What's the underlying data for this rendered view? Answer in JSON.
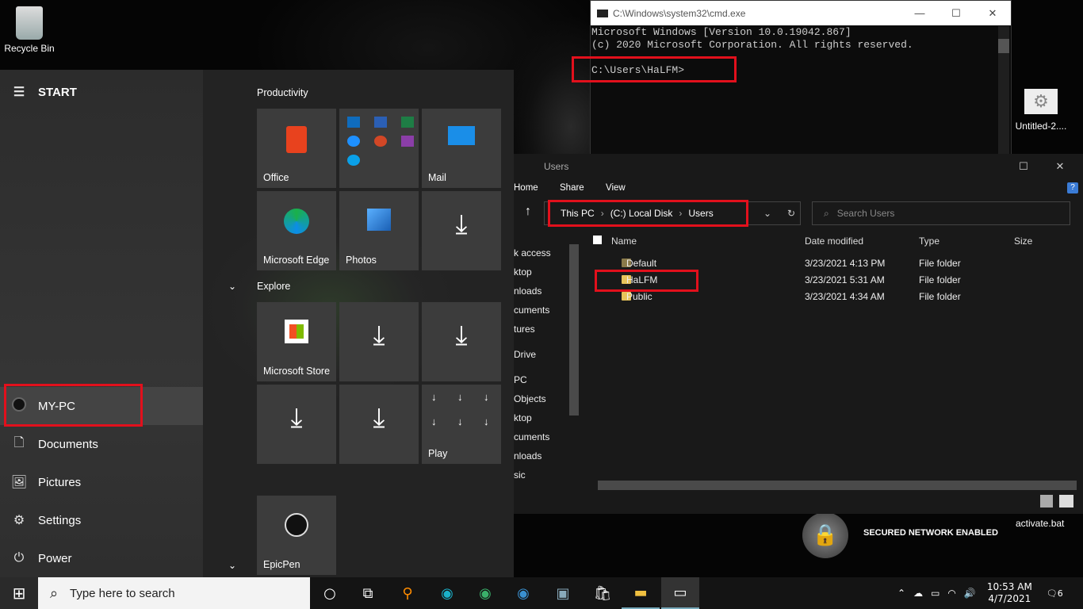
{
  "desktop": {
    "recycle_bin": "Recycle Bin",
    "untitled": "Untitled-2....",
    "activate": "activate.bat",
    "secured": "SECURED NETWORK ENABLED"
  },
  "start": {
    "title": "START",
    "user": "MY-PC",
    "documents": "Documents",
    "pictures": "Pictures",
    "settings": "Settings",
    "power": "Power",
    "group1": "Productivity",
    "group2": "Explore",
    "tiles": {
      "office": "Office",
      "mail": "Mail",
      "edge": "Microsoft Edge",
      "photos": "Photos",
      "store": "Microsoft Store",
      "play": "Play",
      "epicpen": "EpicPen"
    }
  },
  "cmd": {
    "title": "C:\\Windows\\system32\\cmd.exe",
    "line1": "Microsoft Windows [Version 10.0.19042.867]",
    "line2": "(c) 2020 Microsoft Corporation. All rights reserved.",
    "prompt": "C:\\Users\\HaLFM>"
  },
  "explorer": {
    "title": "Users",
    "ribbon": [
      "Home",
      "Share",
      "View"
    ],
    "crumbs": [
      "This PC",
      "(C:) Local Disk",
      "Users"
    ],
    "search_placeholder": "Search Users",
    "columns": [
      "Name",
      "Date modified",
      "Type",
      "Size"
    ],
    "nav": [
      "k access",
      "ktop",
      "nloads",
      "cuments",
      "tures",
      "Drive",
      "PC",
      "Objects",
      "ktop",
      "cuments",
      "nloads",
      "sic"
    ],
    "rows": [
      {
        "name": "Default",
        "date": "3/23/2021 4:13 PM",
        "type": "File folder"
      },
      {
        "name": "HaLFM",
        "date": "3/23/2021 5:31 AM",
        "type": "File folder"
      },
      {
        "name": "Public",
        "date": "3/23/2021 4:34 AM",
        "type": "File folder"
      }
    ]
  },
  "taskbar": {
    "search_placeholder": "Type here to search",
    "time": "10:53 AM",
    "date": "4/7/2021",
    "notif": "6"
  }
}
